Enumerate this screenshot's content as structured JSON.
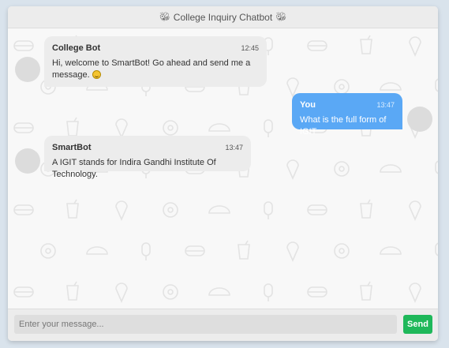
{
  "header": {
    "title": "College Inquiry Chatbot",
    "left_icon": "bug-icon",
    "right_icon": "bug-icon"
  },
  "messages": [
    {
      "sender": "College Bot",
      "time": "12:45",
      "text": "Hi, welcome to SmartBot! Go ahead and send me a message.",
      "emoji": "smile-emoji",
      "side": "left"
    },
    {
      "sender": "You",
      "time": "13:47",
      "text": "What is the full form of IGIT",
      "side": "right"
    },
    {
      "sender": "SmartBot",
      "time": "13:47",
      "text": "A IGIT stands for Indira Gandhi Institute Of Technology.",
      "side": "left"
    }
  ],
  "input": {
    "placeholder": "Enter your message...",
    "value": ""
  },
  "send_label": "Send",
  "colors": {
    "user_bubble": "#5aa8f5",
    "bot_bubble": "#ececec",
    "send_button": "#1fb85a"
  }
}
